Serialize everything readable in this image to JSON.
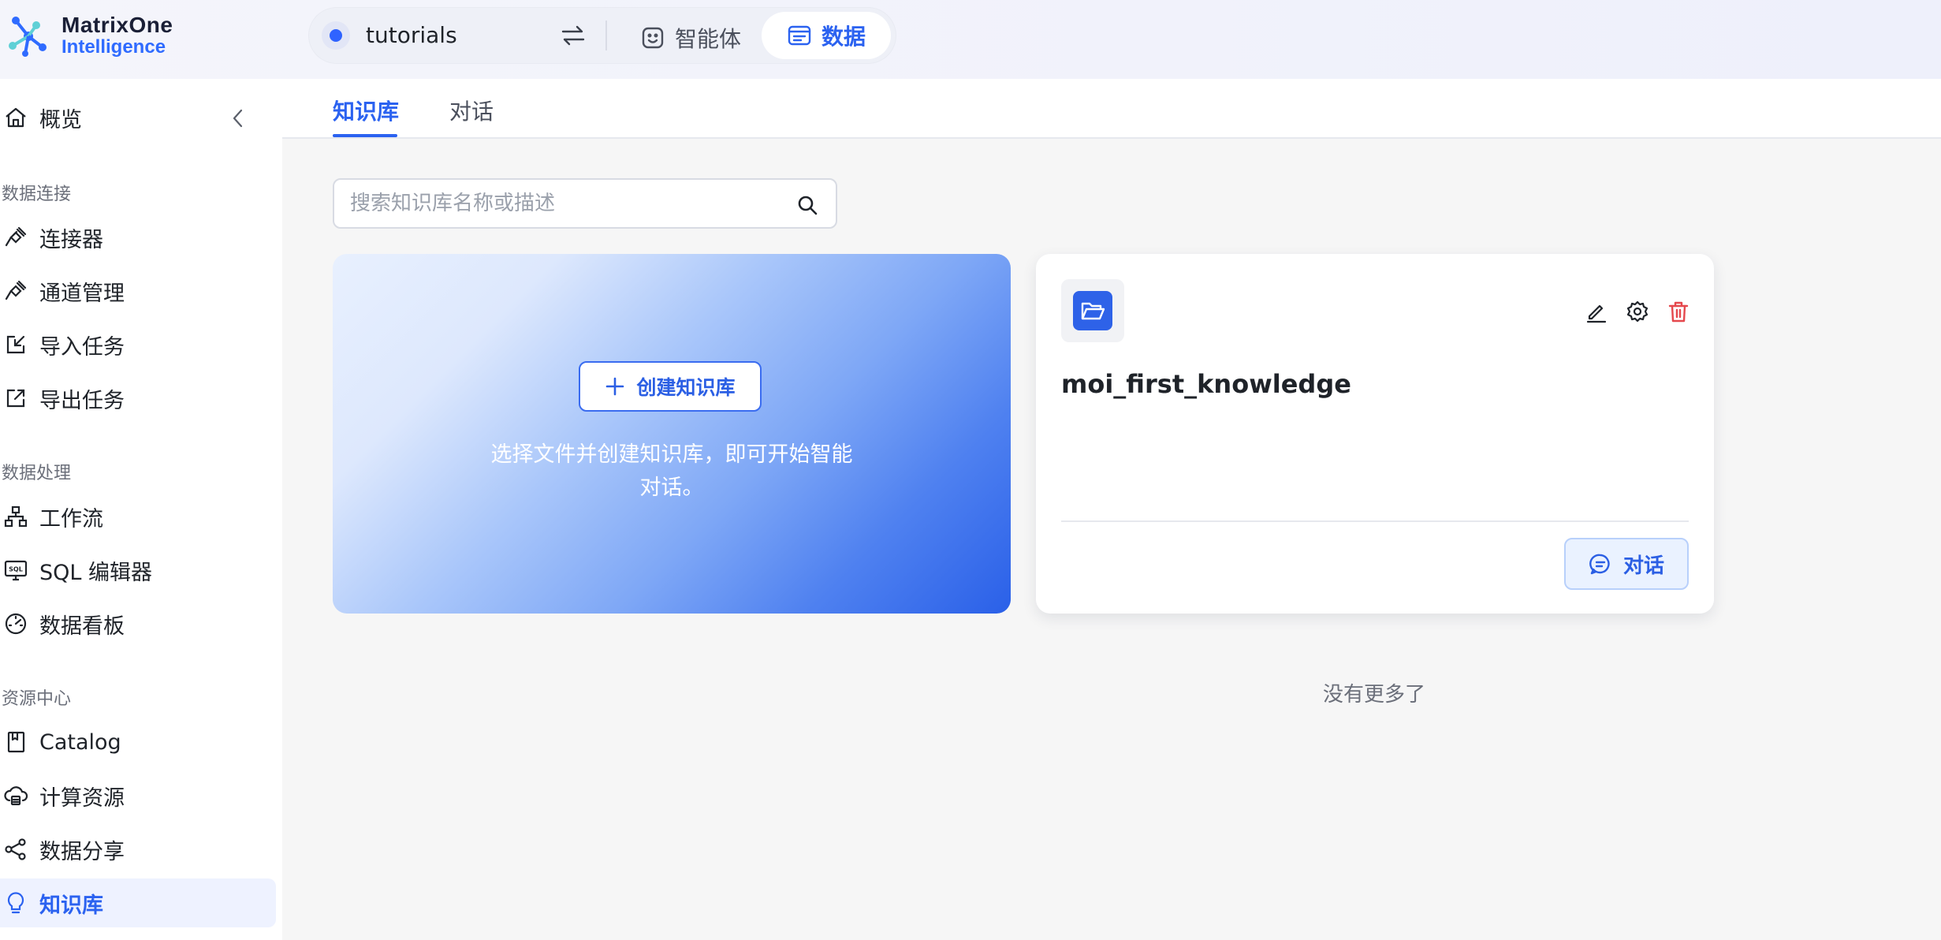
{
  "app": {
    "logo_line1": "MatrixOne",
    "logo_line2": "Intelligence"
  },
  "context": {
    "workspace": "tutorials"
  },
  "top_nav": {
    "agent_label": "智能体",
    "data_label": "数据"
  },
  "sidebar": {
    "overview": "概览",
    "sections": {
      "data_connection": "数据连接",
      "data_processing": "数据处理",
      "resource_center": "资源中心"
    },
    "items": {
      "connector": "连接器",
      "channel": "通道管理",
      "import": "导入任务",
      "export": "导出任务",
      "workflow": "工作流",
      "sql_editor": "SQL 编辑器",
      "dashboard": "数据看板",
      "catalog": "Catalog",
      "compute": "计算资源",
      "share": "数据分享",
      "knowledge": "知识库"
    },
    "active": "knowledge"
  },
  "tabs": [
    {
      "label": "知识库",
      "active": true
    },
    {
      "label": "对话",
      "active": false
    }
  ],
  "search": {
    "placeholder": "搜索知识库名称或描述",
    "value": ""
  },
  "create_card": {
    "button_label": "创建知识库",
    "description": "选择文件并创建知识库，即可开始智能对话。"
  },
  "knowledge_bases": [
    {
      "name": "moi_first_knowledge",
      "chat_label": "对话"
    }
  ],
  "list_end_text": "没有更多了",
  "colors": {
    "accent": "#2b62f0",
    "delete": "#e5484d",
    "sidebar_active_bg": "#eef2ff"
  }
}
